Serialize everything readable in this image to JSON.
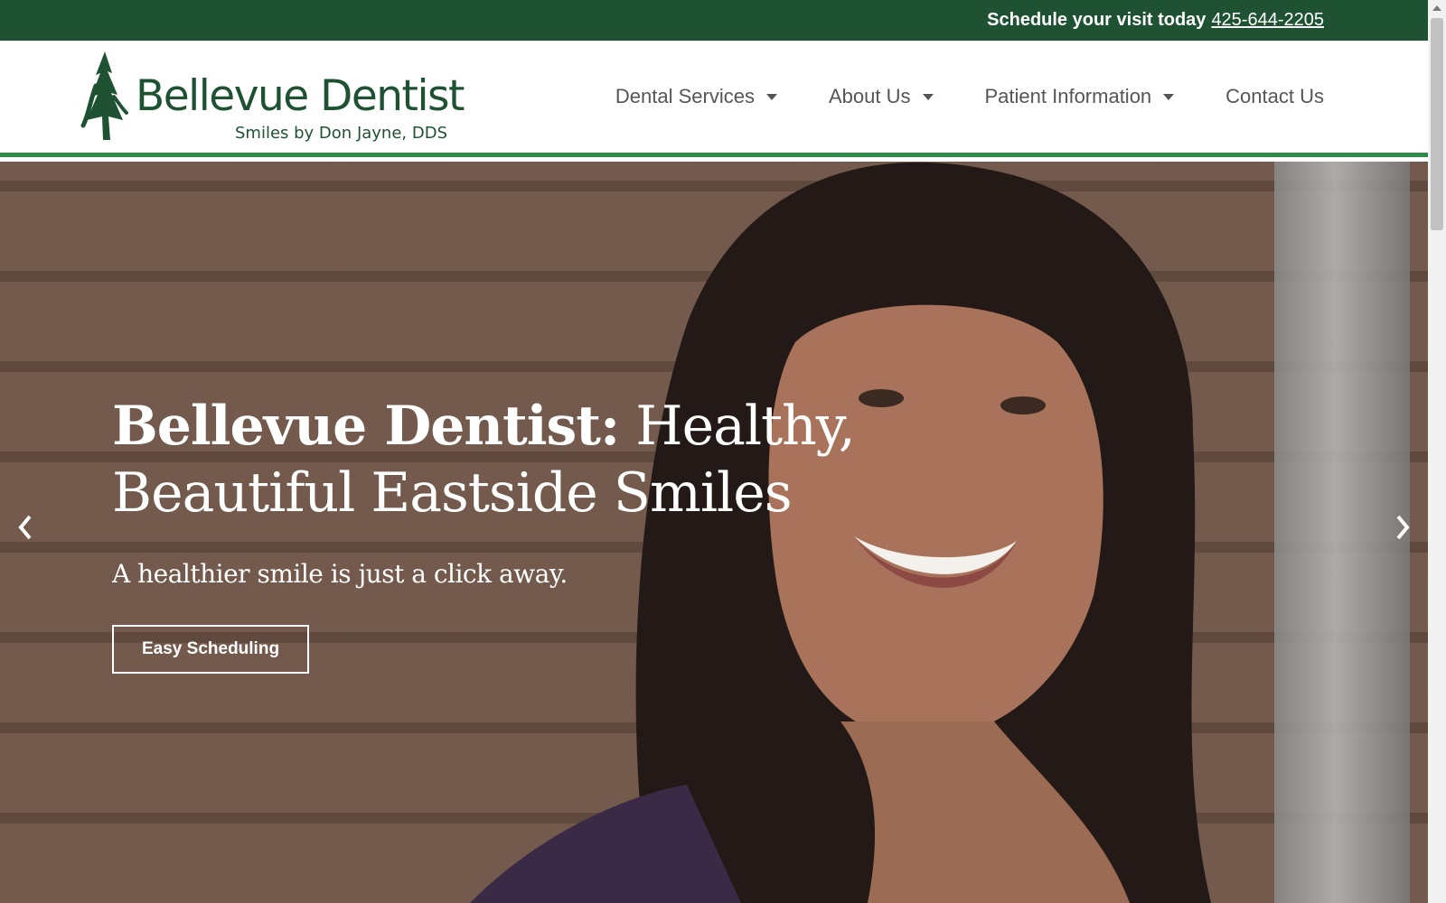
{
  "topbar": {
    "schedule_text": "Schedule your visit today",
    "phone": "425-644-2205"
  },
  "logo": {
    "title": "Bellevue Dentist",
    "subtitle": "Smiles by Don Jayne, DDS",
    "icon": "pine-tree-icon"
  },
  "nav": {
    "items": [
      {
        "label": "Dental Services",
        "has_dropdown": true
      },
      {
        "label": "About Us",
        "has_dropdown": true
      },
      {
        "label": "Patient Information",
        "has_dropdown": true
      },
      {
        "label": "Contact Us",
        "has_dropdown": false
      }
    ]
  },
  "hero": {
    "title_bold": "Bellevue Dentist:",
    "title_rest": " Healthy, Beautiful Eastside Smiles",
    "subtitle": "A healthier smile is just a click away.",
    "button_label": "Easy Scheduling",
    "prev_icon": "chevron-left-icon",
    "next_icon": "chevron-right-icon"
  },
  "colors": {
    "brand_green": "#1f5232",
    "accent_green": "#2e8b4a",
    "nav_text": "#555555"
  }
}
